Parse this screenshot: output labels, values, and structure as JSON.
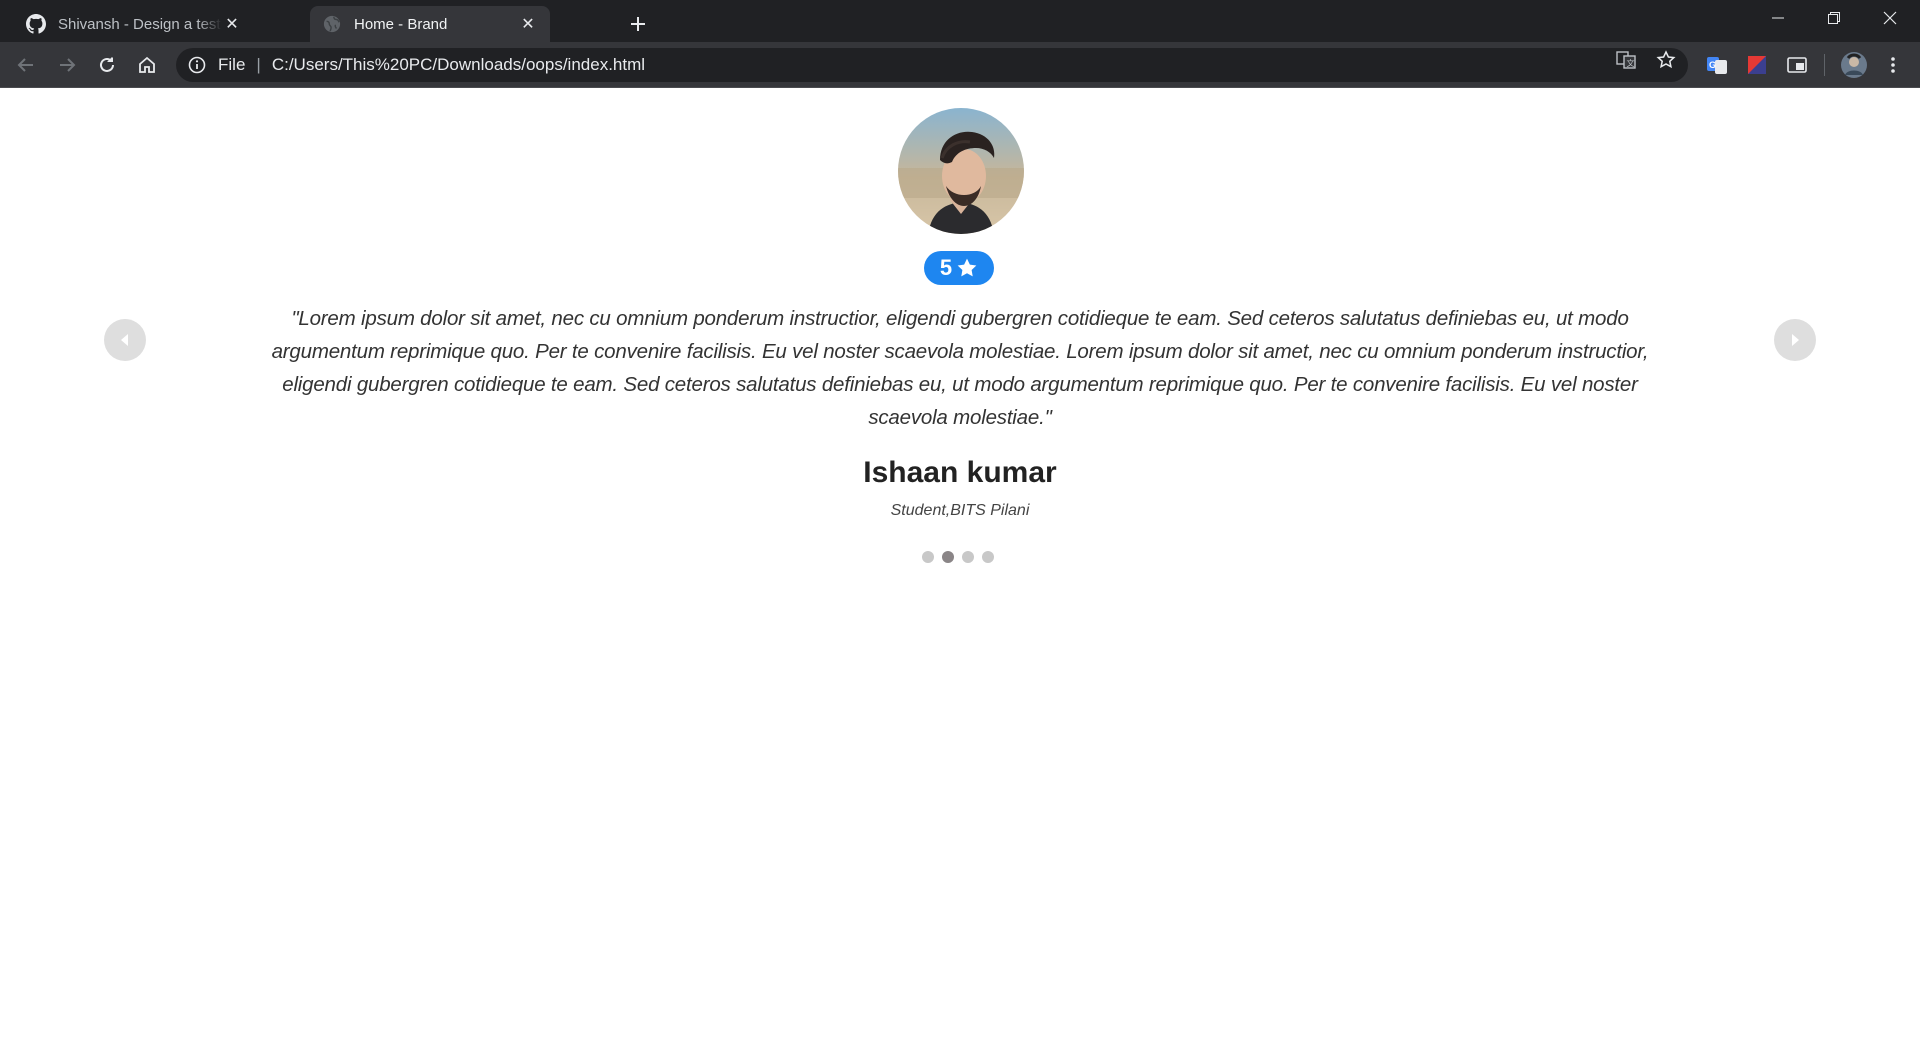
{
  "browser": {
    "tabs": [
      {
        "title": "Shivansh - Design a testimonials",
        "icon": "github-icon",
        "active": false
      },
      {
        "title": "Home - Brand",
        "icon": "globe-icon",
        "active": true
      }
    ],
    "address": {
      "scheme_label": "File",
      "url": "C:/Users/This%20PC/Downloads/oops/index.html"
    }
  },
  "testimonial": {
    "rating": "5",
    "rating_icon": "star-icon",
    "quote": "\"Lorem ipsum dolor sit amet, nec cu omnium ponderum instructior, eligendi gubergren cotidieque te eam. Sed ceteros salutatus definiebas eu, ut modo argumentum reprimique quo. Per te convenire facilisis. Eu vel noster scaevola molestiae. Lorem ipsum dolor sit amet, nec cu omnium ponderum instructior, eligendi gubergren cotidieque te eam. Sed ceteros salutatus definiebas eu, ut modo argumentum reprimique quo. Per te convenire facilisis. Eu vel noster scaevola molestiae.\"",
    "name": "Ishaan kumar",
    "role": "Student,BITS Pilani",
    "slide_count": 4,
    "active_slide": 2
  },
  "colors": {
    "accent": "#1e86f0",
    "chrome_dark": "#202124",
    "chrome_toolbar": "#35363a"
  }
}
